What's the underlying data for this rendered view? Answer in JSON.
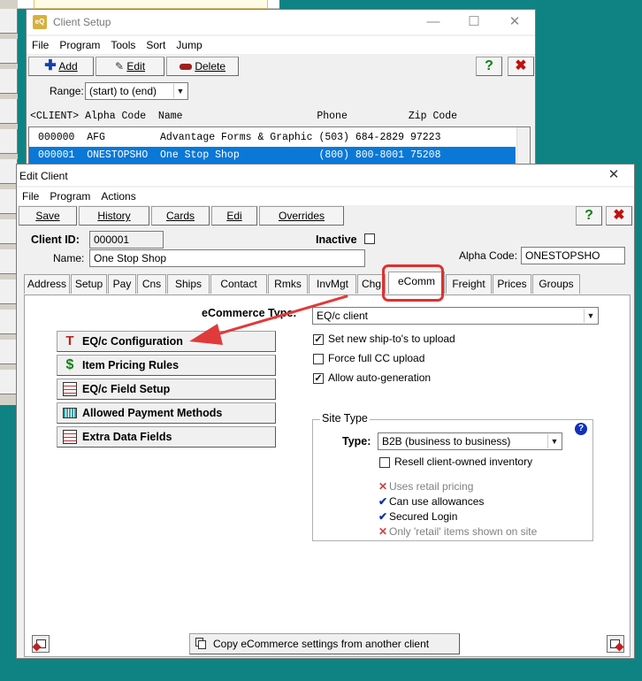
{
  "client_setup": {
    "title": "Client Setup",
    "app_icon_text": "eQ",
    "menu": [
      "File",
      "Program",
      "Tools",
      "Sort",
      "Jump"
    ],
    "toolbar": {
      "add": "Add",
      "edit": "Edit",
      "delete": "Delete"
    },
    "range_label": "Range:",
    "range_value": "(start) to (end)",
    "header": "<CLIENT> Alpha Code  Name                      Phone          Zip Code",
    "rows": [
      "000000  AFG         Advantage Forms & Graphic (503) 684-2829 97223",
      "000001  ONESTOPSHO  One Stop Shop             (800) 800-8001 75208"
    ]
  },
  "edit_client": {
    "title": "Edit Client",
    "menu": [
      "File",
      "Program",
      "Actions"
    ],
    "toolbar": {
      "save": "Save",
      "history": "History",
      "cards": "Cards",
      "edi": "Edi",
      "overrides": "Overrides"
    },
    "client_id_label": "Client ID:",
    "client_id": "000001",
    "inactive_label": "Inactive",
    "name_label": "Name:",
    "name": "One Stop Shop",
    "alpha_label": "Alpha Code:",
    "alpha": "ONESTOPSHO",
    "tabs": [
      "Address",
      "Setup",
      "Pay",
      "Cns",
      "Ships",
      "Contact",
      "Rmks",
      "InvMgt",
      "Chg",
      "eComm",
      "Freight",
      "Prices",
      "Groups"
    ],
    "active_tab": "eComm",
    "ecommerce_type_label": "eCommerce Type:",
    "ecommerce_type": "EQ/c client",
    "buttons": [
      "EQ/c Configuration",
      "Item Pricing Rules",
      "EQ/c Field Setup",
      "Allowed Payment Methods",
      "Extra Data Fields"
    ],
    "checks": [
      {
        "label": "Set new ship-to's to upload",
        "checked": true
      },
      {
        "label": "Force full CC upload",
        "checked": false
      },
      {
        "label": "Allow auto-generation",
        "checked": true
      }
    ],
    "site_type": {
      "legend": "Site Type",
      "type_label": "Type:",
      "type_value": "B2B (business to business)",
      "resell_label": "Resell client-owned inventory",
      "statuses": [
        {
          "label": "Uses retail pricing",
          "mark": "x"
        },
        {
          "label": "Can use allowances",
          "mark": "v"
        },
        {
          "label": "Secured Login",
          "mark": "v"
        },
        {
          "label": "Only 'retail' items shown on site",
          "mark": "x"
        }
      ]
    },
    "copy_button": "Copy eCommerce settings from another client",
    "colors": {
      "highlight_ring": "#e03030",
      "selection": "#0a78d7"
    }
  }
}
